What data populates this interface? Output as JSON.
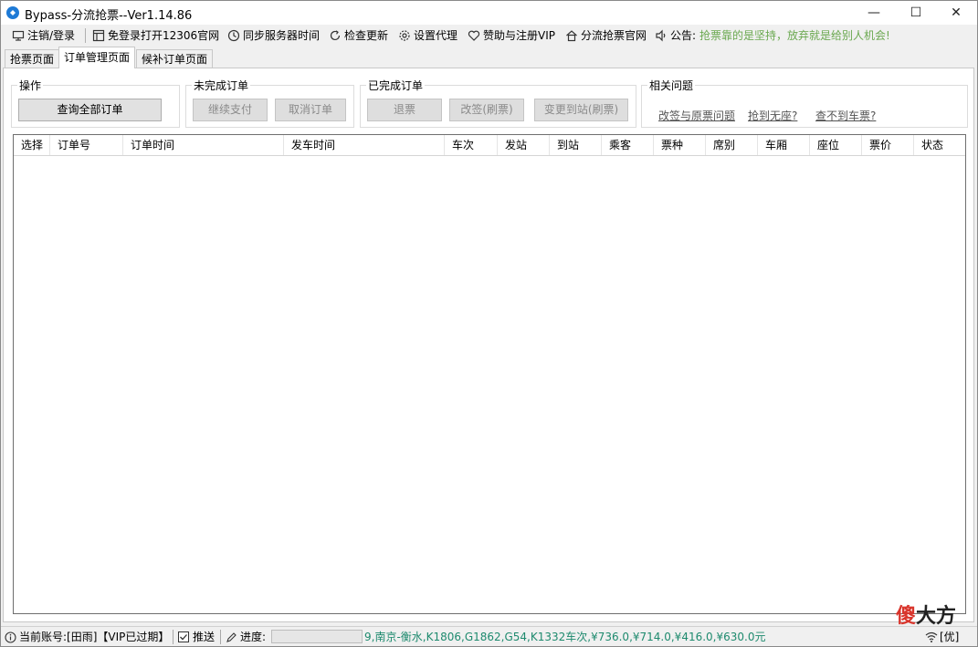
{
  "window": {
    "title": "Bypass-分流抢票--Ver1.14.86",
    "min_glyph": "—",
    "max_glyph": "☐",
    "close_glyph": "✕"
  },
  "toolbar": {
    "logout_login": "注销/登录",
    "open_12306": "免登录打开12306官网",
    "sync_time": "同步服务器时间",
    "check_update": "检查更新",
    "set_proxy": "设置代理",
    "sponsor_vip": "赞助与注册VIP",
    "official_site": "分流抢票官网",
    "notice_label": "公告:",
    "notice_text": "抢票靠的是坚持，放弃就是给别人机会!"
  },
  "tabs": [
    {
      "label": "抢票页面",
      "active": false
    },
    {
      "label": "订单管理页面",
      "active": true
    },
    {
      "label": "候补订单页面",
      "active": false
    }
  ],
  "groups": {
    "operation": {
      "title": "操作",
      "query_all": "查询全部订单"
    },
    "unfinished": {
      "title": "未完成订单",
      "continue_pay": "继续支付",
      "cancel_order": "取消订单"
    },
    "finished": {
      "title": "已完成订单",
      "refund": "退票",
      "change": "改签(刷票)",
      "change_station": "变更到站(刷票)"
    },
    "related": {
      "title": "相关问题",
      "link1": "改签与原票问题",
      "link2": "抢到无座?",
      "link3": "查不到车票?"
    }
  },
  "grid": {
    "columns": [
      "选择",
      "订单号",
      "订单时间",
      "发车时间",
      "车次",
      "发站",
      "到站",
      "乘客",
      "票种",
      "席别",
      "车厢",
      "座位",
      "票价",
      "状态"
    ],
    "rows": []
  },
  "watermark": {
    "part1": "傻",
    "part2": "大方"
  },
  "status": {
    "account": "当前账号:[田雨]【VIP已过期】",
    "push": "推送",
    "progress_label": "进度:",
    "progress_value": 0,
    "route": "9,南京-衡水,K1806,G1862,G54,K1332车次,¥736.0,¥714.0,¥416.0,¥630.0元",
    "network": "[优]"
  },
  "colors": {
    "notice": "#6aa84f",
    "route_text": "#1e8a6e",
    "app_icon": "#1e7ad6",
    "watermark_red": "#d9342b"
  }
}
